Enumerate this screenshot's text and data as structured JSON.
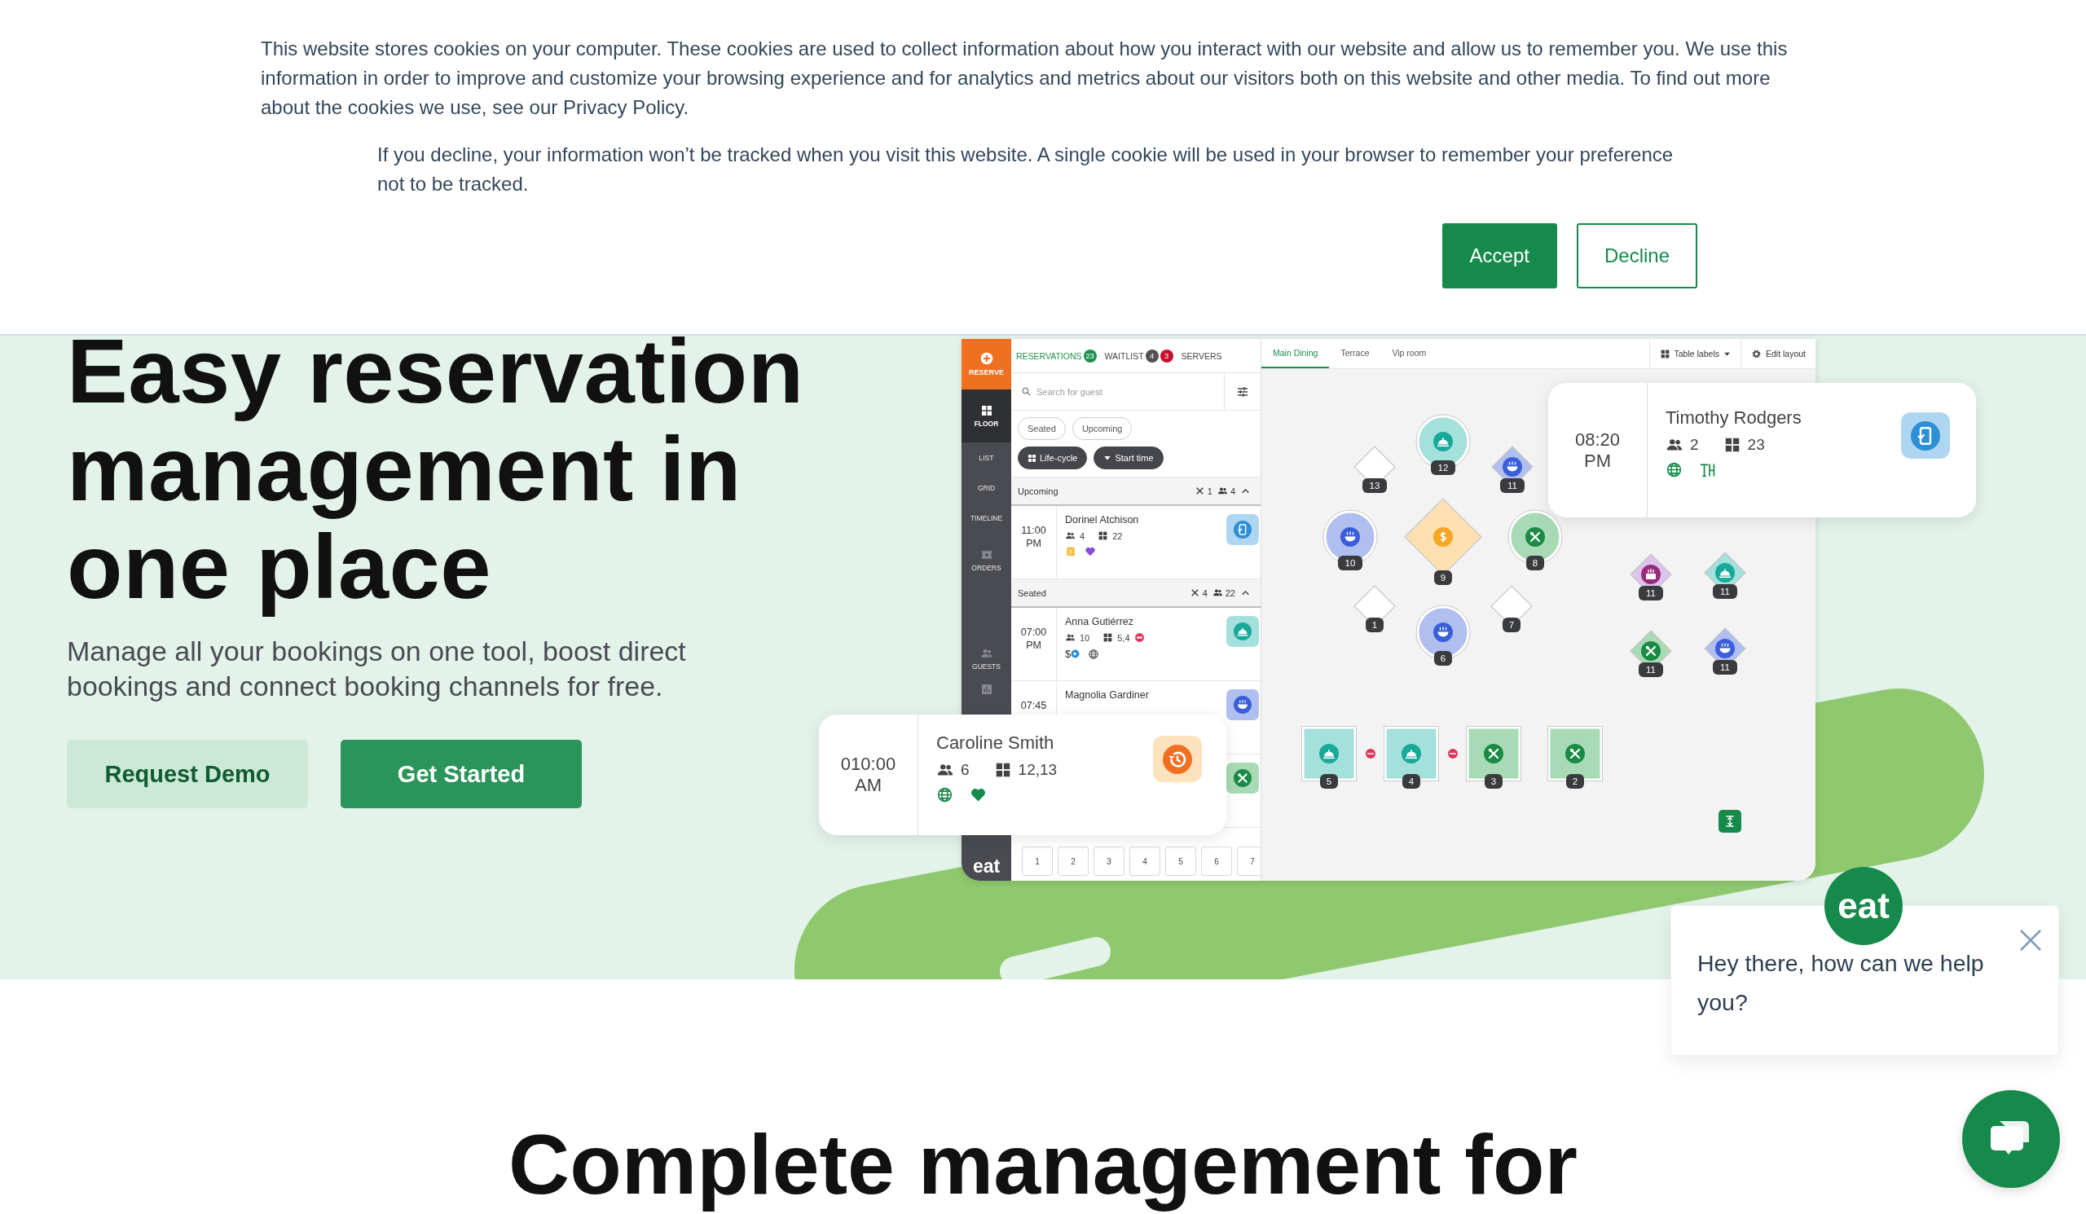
{
  "cookie_banner": {
    "paragraphs": [
      "This website stores cookies on your computer. These cookies are used to collect information about how you interact with our website and allow us to remember you. We use this information in order to improve and customize your browsing experience and for analytics and metrics about our visitors both on this website and other media. To find out more about the cookies we use, see our Privacy Policy.",
      "If you decline, your information won’t be tracked when you visit this website. A single cookie will be used in your browser to remember your preference not to be tracked."
    ],
    "buttons": [
      {
        "label": "Accept",
        "kind": "primary"
      },
      {
        "label": "Decline",
        "kind": "outline"
      }
    ]
  },
  "hero": {
    "heading": "Easy reservation management in one place",
    "subtitle": "Manage all your bookings on one tool, boost direct bookings and connect booking channels for free.",
    "buttons": [
      {
        "label": "Request Demo",
        "kind": "secondary"
      },
      {
        "label": "Get Started",
        "kind": "primary"
      }
    ]
  },
  "app": {
    "sidebar": {
      "reserve": "RESERVE",
      "items": [
        {
          "label": "FLOOR",
          "selected": true
        },
        {
          "label": "LIST",
          "selected": false
        },
        {
          "label": "GRID",
          "selected": false
        },
        {
          "label": "TIMELINE",
          "selected": false
        },
        {
          "label": "ORDERS",
          "selected": false
        }
      ],
      "lower_items": [
        {
          "label": "GUESTS",
          "selected": false
        },
        {
          "selected": false
        }
      ],
      "logo": "eat"
    },
    "list_tabs": [
      {
        "label": "RESERVATIONS",
        "selected": true,
        "badges": [
          {
            "text": "23",
            "color": "#1f8f4e"
          }
        ]
      },
      {
        "label": "WAITLIST",
        "selected": false,
        "badges": [
          {
            "text": "4",
            "color": "#505257"
          },
          {
            "text": "3",
            "color": "#c8102e"
          }
        ]
      },
      {
        "label": "SERVERS",
        "selected": false
      }
    ],
    "search": {
      "placeholder": "Search for guest"
    },
    "filters": [
      {
        "label": "Seated",
        "kind": "chip"
      },
      {
        "label": "Upcoming",
        "kind": "chip"
      },
      {
        "label": "Life-cycle",
        "kind": "group"
      },
      {
        "label": "Start time",
        "kind": "sort"
      }
    ],
    "sections": [
      {
        "title": "Upcoming",
        "tables": "1",
        "guests": "4",
        "expanded": true,
        "reservations": [
          {
            "time": "11:00 PM",
            "name": "Dorinel Atchison",
            "guests": "4",
            "tables": "22",
            "linked": false,
            "tags": [
              {
                "kind": "note"
              },
              {
                "kind": "heart",
                "color": "#8a4fd8"
              }
            ],
            "color": "#aed6f1"
          }
        ]
      },
      {
        "title": "Seated",
        "tables": "4",
        "guests": "22",
        "expanded": true,
        "reservations": [
          {
            "time": "07:00 PM",
            "name": "Anna Gutiérrez",
            "guests": "10",
            "tables": "5,4",
            "linked": true,
            "tags": [
              {
                "kind": "prepaid",
                "label": "$"
              },
              {
                "kind": "web"
              }
            ],
            "color": "#a4e0dc"
          },
          {
            "time": "07:45",
            "name": "Magnolia Gardiner",
            "color": "#b0bff0"
          },
          {
            "color": "#a8dbb5"
          }
        ]
      }
    ],
    "table_tiles": [
      "1",
      "2",
      "3",
      "4",
      "5",
      "6",
      "7"
    ],
    "floor": {
      "rooms": [
        {
          "label": "Main Dining",
          "selected": true
        },
        {
          "label": "Terrace",
          "selected": false
        },
        {
          "label": "Vip room",
          "selected": false
        }
      ],
      "table_labels": "Table labels",
      "edit_layout": "Edit layout",
      "tables": [
        {
          "number": "13",
          "kind": "diamond",
          "color": "#ffffff"
        },
        {
          "number": "12",
          "kind": "round",
          "color": "#a4e0dc"
        },
        {
          "number": "11",
          "kind": "diamond",
          "color": "#b0bff0"
        },
        {
          "number": "10",
          "kind": "round",
          "color": "#b0bff0"
        },
        {
          "number": "9",
          "kind": "large_diamond",
          "color": "#fde0b0"
        },
        {
          "number": "8",
          "kind": "round",
          "color": "#a8dbb5"
        },
        {
          "number": "1",
          "kind": "diamond",
          "color": "#ffffff"
        },
        {
          "number": "6",
          "kind": "round",
          "color": "#b0bff0"
        },
        {
          "number": "7",
          "kind": "diamond",
          "color": "#ffffff"
        },
        {
          "number": "11",
          "kind": "diamond",
          "color": "#dcc4ec"
        },
        {
          "number": "11",
          "kind": "diamond",
          "color": "#a4e0dc"
        },
        {
          "number": "11",
          "kind": "diamond",
          "color": "#a8dbb5"
        },
        {
          "number": "11",
          "kind": "diamond",
          "color": "#b0bff0"
        },
        {
          "number": "5",
          "kind": "square",
          "color": "#a4e0dc",
          "linked": true
        },
        {
          "number": "4",
          "kind": "square",
          "color": "#a4e0dc",
          "linked": true
        },
        {
          "number": "3",
          "kind": "square",
          "color": "#a8dbb5",
          "linked": false
        },
        {
          "number": "2",
          "kind": "square",
          "color": "#a8dbb5",
          "linked": false
        }
      ]
    }
  },
  "popups": [
    {
      "time": "010:00 AM",
      "name": "Caroline Smith",
      "guests": "6",
      "tables": "12,13",
      "tags": [
        {
          "kind": "web"
        },
        {
          "kind": "heart",
          "color": "#158a4a"
        }
      ],
      "color": "#fde3bd"
    },
    {
      "time": "08:20 PM",
      "name": "Timothy Rodgers",
      "guests": "2",
      "tables": "23",
      "tags": [
        {
          "kind": "web"
        },
        {
          "kind": "walkin"
        }
      ],
      "color": "#aed6f1"
    }
  ],
  "chat": {
    "logo": "eat",
    "message": "Hey there, how can we help you?"
  },
  "next_section": {
    "heading": "Complete management for"
  }
}
